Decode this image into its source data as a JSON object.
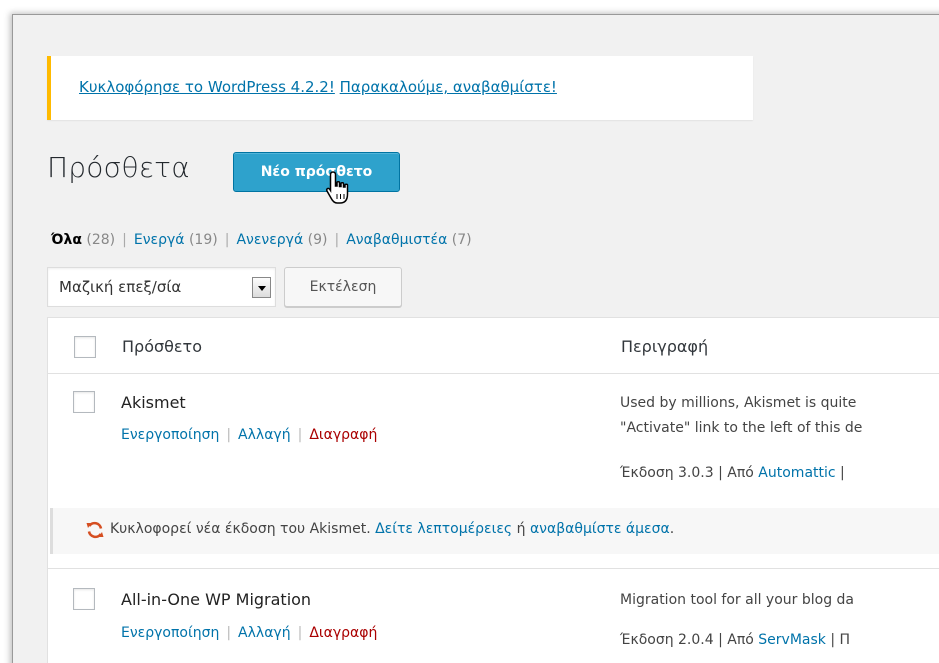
{
  "notice": {
    "link1": "Κυκλοφόρησε το WordPress 4.2.2!",
    "link2": "Παρακαλούμε, αναβαθμίστε!"
  },
  "page": {
    "title": "Πρόσθετα",
    "add_new": "Νέο πρόσθετο"
  },
  "filters": {
    "all": {
      "label": "Όλα",
      "count": "(28)"
    },
    "active": {
      "label": "Ενεργά",
      "count": "(19)"
    },
    "inactive": {
      "label": "Ανενεργά",
      "count": "(9)"
    },
    "updates": {
      "label": "Αναβαθμιστέα",
      "count": "(7)"
    },
    "separator": "|"
  },
  "bulk": {
    "selected": "Μαζική επεξ/σία",
    "apply": "Εκτέλεση"
  },
  "table": {
    "col_plugin": "Πρόσθετο",
    "col_description": "Περιγραφή"
  },
  "actions": {
    "activate": "Ενεργοποίηση",
    "edit": "Αλλαγή",
    "delete": "Διαγραφή",
    "separator": "|"
  },
  "plugins": [
    {
      "name": "Akismet",
      "desc_line1": "Used by millions, Akismet is quite",
      "desc_line2": "\"Activate\" link to the left of this de",
      "version_prefix": "Έκδοση 3.0.3 | Από",
      "author": "Automattic",
      "meta_tail": "|"
    },
    {
      "name": "All-in-One WP Migration",
      "desc_line1": "Migration tool for all your blog da",
      "version_prefix": "Έκδοση 2.0.4 | Από",
      "author": "ServMask",
      "meta_tail": "| Π"
    }
  ],
  "update_notice": {
    "text": "Κυκλοφορεί νέα έκδοση του Akismet.",
    "details_link": "Δείτε λεπτομέρειες",
    "or": "ή",
    "update_link": "αναβαθμίστε άμεσα",
    "end": "."
  },
  "colors": {
    "accent": "#2ea2cc",
    "link": "#0073aa",
    "delete": "#a00000",
    "notice_border": "#ffba00"
  }
}
